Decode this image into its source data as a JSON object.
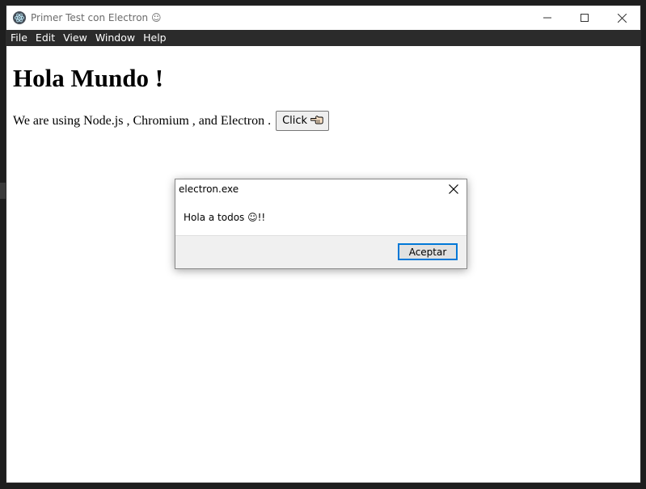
{
  "window": {
    "title": "Primer Test con Electron ☺"
  },
  "menubar": {
    "items": [
      "File",
      "Edit",
      "View",
      "Window",
      "Help"
    ]
  },
  "page": {
    "heading": "Hola Mundo !",
    "text_prefix": "We are using Node.js , Chromium , and Electron .",
    "click_label": "Click",
    "click_icon": "hand-pointing-left-icon"
  },
  "dialog": {
    "title": "electron.exe",
    "message": "Hola a todos ☺!!",
    "ok_label": "Aceptar"
  },
  "colors": {
    "menubar_bg": "#2b2b2b",
    "accent_focus": "#0078d7"
  }
}
